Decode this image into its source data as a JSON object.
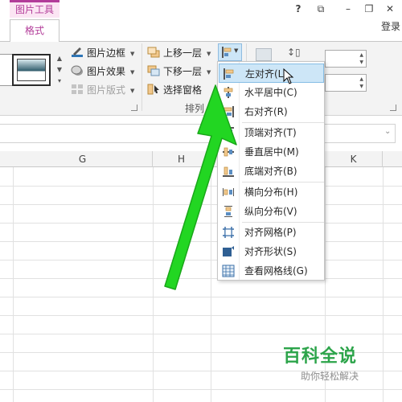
{
  "title_bar": {
    "context_tab": "图片工具",
    "login": "登录",
    "help_glyph": "?",
    "restore_glyph": "⧉",
    "minimize_glyph": "–",
    "maximize_glyph": "❐",
    "close_glyph": "✕"
  },
  "tabs": {
    "format": "格式"
  },
  "ribbon": {
    "picture_styles": {
      "border": "图片边框",
      "effects": "图片效果",
      "layout": "图片版式"
    },
    "arrange": {
      "bring_forward": "上移一层",
      "send_backward": "下移一层",
      "selection_pane": "选择窗格",
      "group_label": "排列"
    }
  },
  "align_menu": {
    "items": [
      {
        "label": "左对齐(L)",
        "icon": "align-left-icon"
      },
      {
        "label": "水平居中(C)",
        "icon": "align-center-icon"
      },
      {
        "label": "右对齐(R)",
        "icon": "align-right-icon"
      },
      {
        "label": "顶端对齐(T)",
        "icon": "align-top-icon"
      },
      {
        "label": "垂直居中(M)",
        "icon": "align-middle-icon"
      },
      {
        "label": "底端对齐(B)",
        "icon": "align-bottom-icon"
      },
      {
        "label": "横向分布(H)",
        "icon": "distribute-horizontal-icon"
      },
      {
        "label": "纵向分布(V)",
        "icon": "distribute-vertical-icon"
      },
      {
        "label": "对齐网格(P)",
        "icon": "snap-to-grid-icon"
      },
      {
        "label": "对齐形状(S)",
        "icon": "snap-to-shape-icon"
      },
      {
        "label": "查看网格线(G)",
        "icon": "view-gridlines-icon"
      }
    ],
    "highlighted_index": 0
  },
  "grid": {
    "columns": [
      "G",
      "H",
      "J",
      "K"
    ]
  },
  "watermark": {
    "logo": "百科全说",
    "tagline": "助你轻松解决"
  },
  "colors": {
    "context_accent": "#b23c99",
    "menu_highlight": "#cde6f7",
    "arrow_green": "#22d622",
    "watermark_green": "#2ca44a"
  }
}
